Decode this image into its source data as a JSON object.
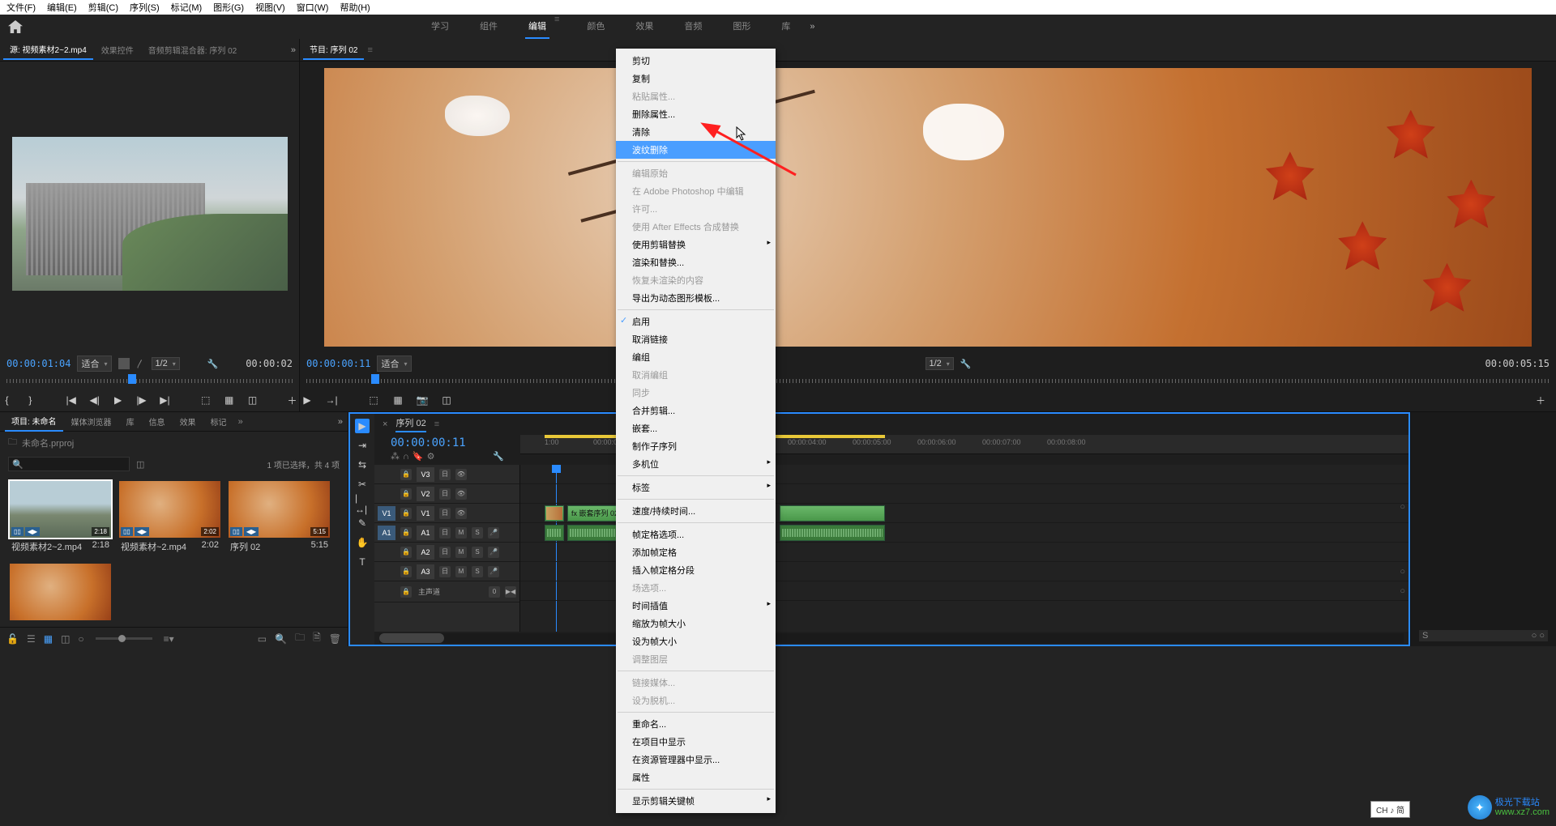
{
  "menubar": [
    "文件(F)",
    "编辑(E)",
    "剪辑(C)",
    "序列(S)",
    "标记(M)",
    "图形(G)",
    "视图(V)",
    "窗口(W)",
    "帮助(H)"
  ],
  "workspaces": {
    "items": [
      "学习",
      "组件",
      "编辑",
      "颜色",
      "效果",
      "音频",
      "图形",
      "库"
    ],
    "active_index": 2
  },
  "source_panel": {
    "tabs": {
      "active": "源: 视频素材2~2.mp4",
      "others": [
        "效果控件",
        "音频剪辑混合器: 序列 02"
      ]
    },
    "timecode_left": "00:00:01:04",
    "fit_label": "适合",
    "zoom_label": "1/2",
    "timecode_right": "00:00:02"
  },
  "program_panel": {
    "tab": "节目: 序列 02",
    "timecode_left": "00:00:00:11",
    "fit_label": "适合",
    "zoom_label": "1/2",
    "timecode_right": "00:00:05:15"
  },
  "context_menu": {
    "groups": [
      [
        {
          "label": "剪切"
        },
        {
          "label": "复制"
        },
        {
          "label": "粘贴属性...",
          "disabled": true
        },
        {
          "label": "删除属性..."
        },
        {
          "label": "清除"
        },
        {
          "label": "波纹删除",
          "highlighted": true
        }
      ],
      [
        {
          "label": "编辑原始",
          "disabled": true
        },
        {
          "label": "在 Adobe Photoshop 中编辑",
          "disabled": true
        },
        {
          "label": "许可...",
          "disabled": true
        },
        {
          "label": "使用 After Effects 合成替换",
          "disabled": true
        },
        {
          "label": "使用剪辑替换",
          "submenu": true
        },
        {
          "label": "渲染和替换..."
        },
        {
          "label": "恢复未渲染的内容",
          "disabled": true
        },
        {
          "label": "导出为动态图形模板..."
        }
      ],
      [
        {
          "label": "启用",
          "checked": true
        },
        {
          "label": "取消链接"
        },
        {
          "label": "编组"
        },
        {
          "label": "取消编组",
          "disabled": true
        },
        {
          "label": "同步",
          "disabled": true
        },
        {
          "label": "合并剪辑..."
        },
        {
          "label": "嵌套..."
        },
        {
          "label": "制作子序列"
        },
        {
          "label": "多机位",
          "submenu": true
        }
      ],
      [
        {
          "label": "标签",
          "submenu": true
        }
      ],
      [
        {
          "label": "速度/持续时间..."
        }
      ],
      [
        {
          "label": "帧定格选项..."
        },
        {
          "label": "添加帧定格"
        },
        {
          "label": "插入帧定格分段"
        },
        {
          "label": "场选项...",
          "disabled": true
        },
        {
          "label": "时间插值",
          "submenu": true
        },
        {
          "label": "缩放为帧大小"
        },
        {
          "label": "设为帧大小"
        },
        {
          "label": "调整图层",
          "disabled": true
        }
      ],
      [
        {
          "label": "链接媒体...",
          "disabled": true
        },
        {
          "label": "设为脱机...",
          "disabled": true
        }
      ],
      [
        {
          "label": "重命名..."
        },
        {
          "label": "在项目中显示"
        },
        {
          "label": "在资源管理器中显示..."
        },
        {
          "label": "属性"
        }
      ],
      [
        {
          "label": "显示剪辑关键帧",
          "submenu": true
        }
      ]
    ]
  },
  "project_panel": {
    "tabs": [
      "项目: 未命名",
      "媒体浏览器",
      "库",
      "信息",
      "效果",
      "标记"
    ],
    "active_tab": 0,
    "path_label": "未命名.prproj",
    "search_placeholder": "",
    "status": "1 项已选择，共 4 项",
    "bins": [
      {
        "name": "视频素材2~2.mp4",
        "duration": "2:18",
        "type": "city",
        "selected": true,
        "av": true
      },
      {
        "name": "视频素材~2.mp4",
        "duration": "2:02",
        "type": "leaves",
        "av": true
      },
      {
        "name": "序列 02",
        "duration": "5:15",
        "type": "leaves",
        "av": true
      }
    ],
    "extra_thumb": {
      "type": "leaves"
    }
  },
  "timeline": {
    "sequence_name": "序列 02",
    "timecode": "00:00:00:11",
    "ruler": [
      "1:00",
      "00:00:01:00",
      "00:00:04:00",
      "00:00:05:00",
      "00:00:06:00",
      "00:00:07:00",
      "00:00:08:00"
    ],
    "video_tracks": [
      "V3",
      "V2",
      "V1"
    ],
    "audio_tracks": [
      "A1",
      "A2",
      "A3"
    ],
    "master_label": "主声道",
    "source_patches": {
      "v": "V1",
      "a": "A1"
    },
    "clips": {
      "v1_a": {
        "label": ""
      },
      "v1_b": {
        "label": "fx 嵌套序列 02"
      }
    },
    "track_btns": {
      "mute": "M",
      "solo": "S",
      "lock": "🔒",
      "eye": "👁",
      "pad": "0"
    }
  },
  "ime": "CH ♪ 简",
  "watermark": {
    "brand": "极光下载站",
    "url": "www.xz7.com"
  }
}
